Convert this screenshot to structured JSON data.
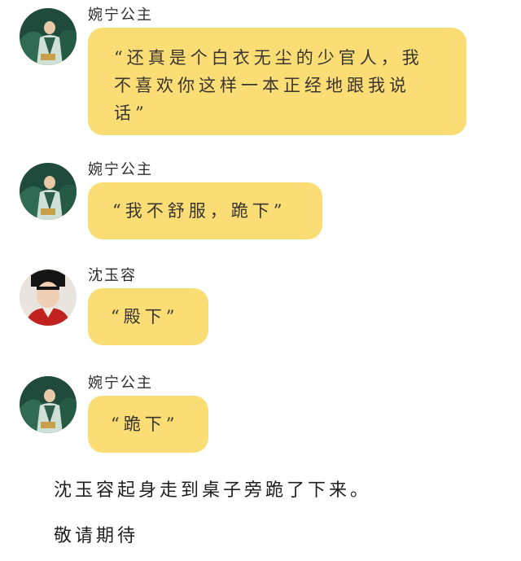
{
  "messages": [
    {
      "sender": "婉宁公主",
      "avatar_icon": "princess-avatar",
      "text": "“还真是个白衣无尘的少官人，我不喜欢你这样一本正经地跟我说话”"
    },
    {
      "sender": "婉宁公主",
      "avatar_icon": "princess-avatar",
      "text": "“我不舒服，跪下”"
    },
    {
      "sender": "沈玉容",
      "avatar_icon": "official-avatar",
      "text": "“殿下”"
    },
    {
      "sender": "婉宁公主",
      "avatar_icon": "princess-avatar",
      "text": "“跪下”"
    }
  ],
  "narration": {
    "line1": "沈玉容起身走到桌子旁跪了下来。",
    "line2": "敬请期待"
  },
  "colors": {
    "bubble": "#fbdd75",
    "text": "#3a3530"
  }
}
